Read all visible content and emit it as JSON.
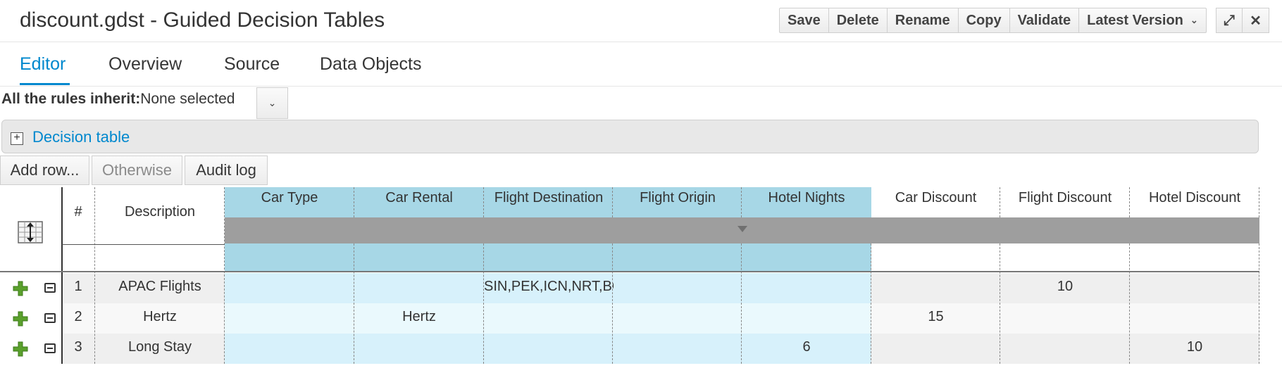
{
  "header": {
    "title": "discount.gdst - Guided Decision Tables",
    "toolbar": {
      "save": "Save",
      "delete": "Delete",
      "rename": "Rename",
      "copy": "Copy",
      "validate": "Validate",
      "version": "Latest Version"
    },
    "window": {
      "expand_icon": "⤢",
      "close_icon": "✕"
    }
  },
  "tabs": [
    {
      "label": "Editor",
      "active": true
    },
    {
      "label": "Overview",
      "active": false
    },
    {
      "label": "Source",
      "active": false
    },
    {
      "label": "Data Objects",
      "active": false
    }
  ],
  "inherit": {
    "label": "All the rules inherit:",
    "value": "None selected"
  },
  "panel": {
    "title": "Decision table",
    "toggle": "+"
  },
  "actions": {
    "add_row": "Add row...",
    "otherwise": "Otherwise",
    "audit_log": "Audit log"
  },
  "table": {
    "columns": {
      "num": "#",
      "description": "Description",
      "car_type": "Car Type",
      "car_rental": "Car Rental",
      "flight_destination": "Flight Destination",
      "flight_origin": "Flight Origin",
      "hotel_nights": "Hotel Nights",
      "car_discount": "Car Discount",
      "flight_discount": "Flight Discount",
      "hotel_discount": "Hotel Discount"
    },
    "rows": [
      {
        "num": "1",
        "description": "APAC Flights",
        "car_type": "",
        "car_rental": "",
        "flight_destination": "SIN,PEK,ICN,NRT,BO",
        "flight_origin": "",
        "hotel_nights": "",
        "car_discount": "",
        "flight_discount": "10",
        "hotel_discount": ""
      },
      {
        "num": "2",
        "description": "Hertz",
        "car_type": "",
        "car_rental": "Hertz",
        "flight_destination": "",
        "flight_origin": "",
        "hotel_nights": "",
        "car_discount": "15",
        "flight_discount": "",
        "hotel_discount": ""
      },
      {
        "num": "3",
        "description": "Long Stay",
        "car_type": "",
        "car_rental": "",
        "flight_destination": "",
        "flight_origin": "",
        "hotel_nights": "6",
        "car_discount": "",
        "flight_discount": "",
        "hotel_discount": "10"
      }
    ]
  },
  "colors": {
    "accent": "#0088ce",
    "header_condition": "#a7d7e6",
    "row_condition_light": "#d7f1fb",
    "row_condition_pale": "#eaf9fd",
    "row_action_grey": "#efefef",
    "add_icon_green": "#5aa02c"
  }
}
